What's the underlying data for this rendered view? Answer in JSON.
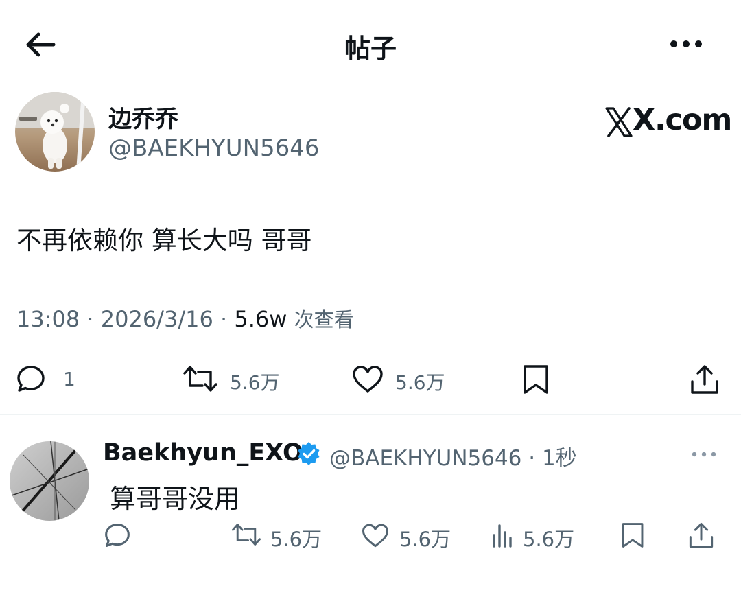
{
  "header": {
    "title": "帖子",
    "back_icon": "arrow-left-icon",
    "more_icon": "more-horizontal-icon"
  },
  "post": {
    "author_name": "边乔乔",
    "author_handle": "@BAEKHYUN5646",
    "brand": "X.com",
    "text": "不再依赖你 算长大吗 哥哥",
    "time": "13:08",
    "date": "2026/3/16",
    "separator": "·",
    "views_count": "5.6w",
    "views_label": "次查看",
    "replies": "1",
    "reposts": "5.6万",
    "likes": "5.6万"
  },
  "reply": {
    "author_name": "Baekhyun_EXO",
    "author_handle": "@BAEKHYUN5646 · 1秒",
    "text": "算哥哥没用",
    "reposts": "5.6万",
    "likes": "5.6万",
    "views": "5.6万"
  },
  "colors": {
    "text_primary": "#0f1419",
    "text_secondary": "#536471",
    "verified_blue": "#1d9bf0",
    "divider": "#eff3f4"
  }
}
